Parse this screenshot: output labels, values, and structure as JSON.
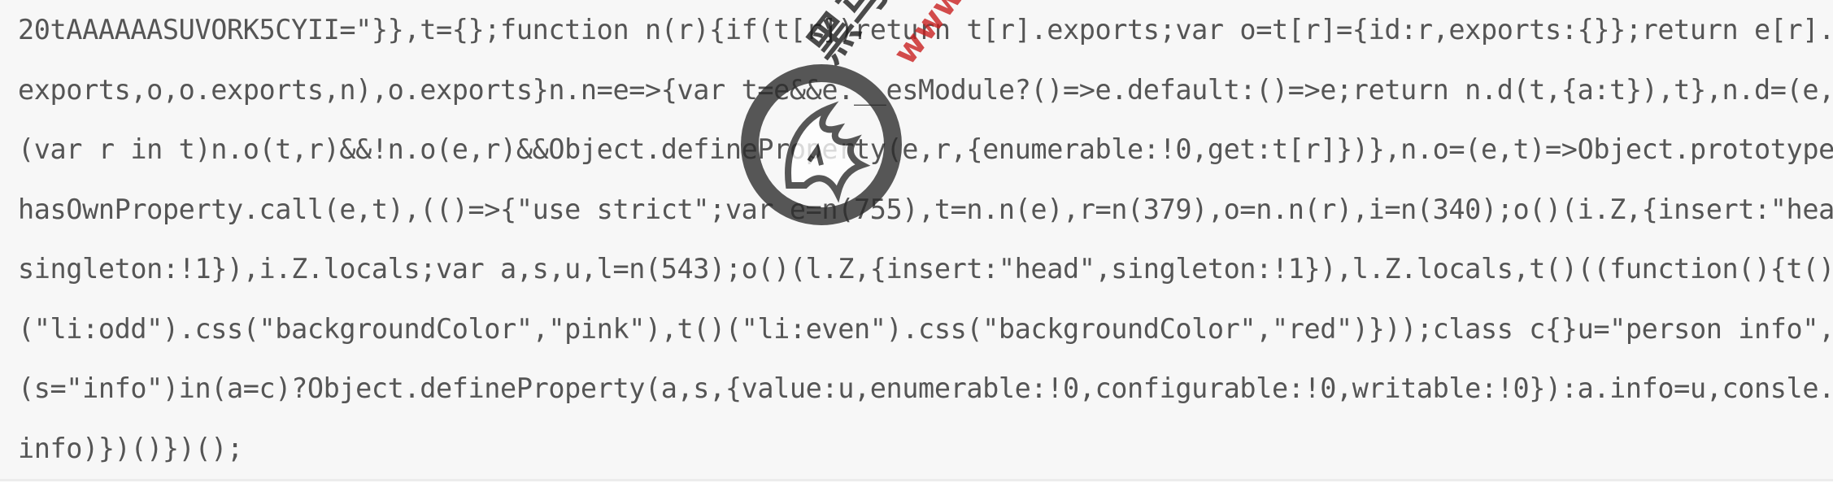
{
  "code_block": {
    "lines": [
      "20tAAAAAASUVORK5CYII=\"}},t={};function n(r){if(t[r])return t[r].exports;var o=t[r]={id:r,exports:{}};return e[r].call(o.",
      "exports,o,o.exports,n),o.exports}n.n=e=>{var t=e&&e.__esModule?()=>e.default:()=>e;return n.d(t,{a:t}),t},n.d=(e,t)=>{for",
      "(var r in t)n.o(t,r)&&!n.o(e,r)&&Object.defineProperty(e,r,{enumerable:!0,get:t[r]})},n.o=(e,t)=>Object.prototype.",
      "hasOwnProperty.call(e,t),(()=>{\"use strict\";var e=n(755),t=n.n(e),r=n(379),o=n.n(r),i=n(340);o()(i.Z,{insert:\"head\",",
      "singleton:!1}),i.Z.locals;var a,s,u,l=n(543);o()(l.Z,{insert:\"head\",singleton:!1}),l.Z.locals,t()((function(){t()",
      "(\"li:odd\").css(\"backgroundColor\",\"pink\"),t()(\"li:even\").css(\"backgroundColor\",\"red\")}));class c{}u=\"person info\",",
      "(s=\"info\")in(a=c)?Object.defineProperty(a,s,{value:u,enumerable:!0,configurable:!0,writable:!0}):a.info=u,consle.log(c.",
      "info)})()})();"
    ]
  },
  "watermark": {
    "cn_text": "黑马",
    "url_text": "www.itheima.com",
    "seal_icon": "wolf-head-logo-icon",
    "url_color": "#c81c1c",
    "seal_color": "#2a2a2a"
  }
}
